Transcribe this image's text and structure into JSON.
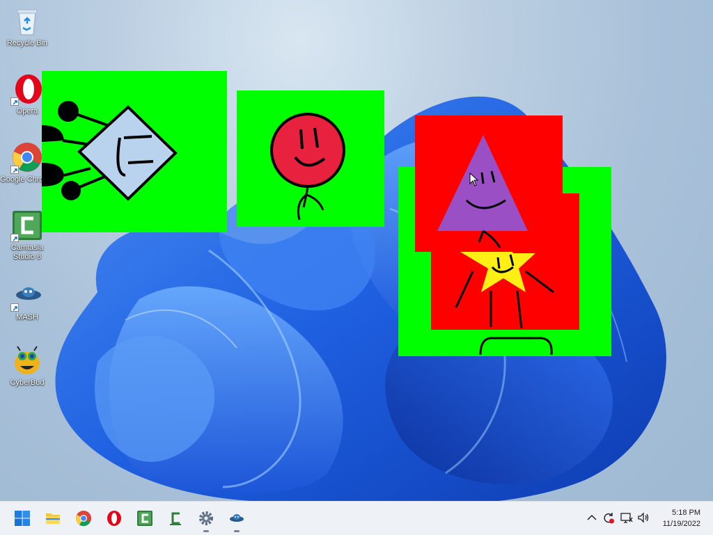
{
  "desktop_icons": [
    {
      "label": "Recycle Bin",
      "icon": "recycle-bin-icon"
    },
    {
      "label": "Opera",
      "icon": "opera-icon"
    },
    {
      "label": "Google Chrome",
      "icon": "chrome-icon"
    },
    {
      "label": "Camtasia Studio 8",
      "icon": "camtasia-icon"
    },
    {
      "label": "MASH",
      "icon": "mash-icon"
    },
    {
      "label": "CyberBud",
      "icon": "cyberbud-icon"
    }
  ],
  "sprites": [
    {
      "name": "diamond-character",
      "background": "#00ff00",
      "fill": "#b9d3ee"
    },
    {
      "name": "circle-character",
      "background": "#00ff00",
      "fill": "#e8213f"
    },
    {
      "name": "triangle-character",
      "background": "#ff0000",
      "fill": "#9b4fc4"
    },
    {
      "name": "star-character",
      "background": "#ff0000",
      "fill": "#ffef14"
    },
    {
      "name": "green-card",
      "background": "#00ff00"
    }
  ],
  "taskbar": {
    "apps": [
      "start-icon",
      "file-explorer-icon",
      "chrome-icon",
      "opera-icon",
      "camtasia-icon",
      "camtasia-recorder-icon",
      "settings-icon",
      "mash-icon"
    ],
    "tray": [
      "chevron-up-icon",
      "sync-icon",
      "network-icon",
      "volume-icon"
    ],
    "time": "5:18 PM",
    "date": "11/19/2022"
  },
  "colors": {
    "accent": "#0067c0",
    "sprite_green": "#00ff00",
    "sprite_red": "#ff0000"
  }
}
